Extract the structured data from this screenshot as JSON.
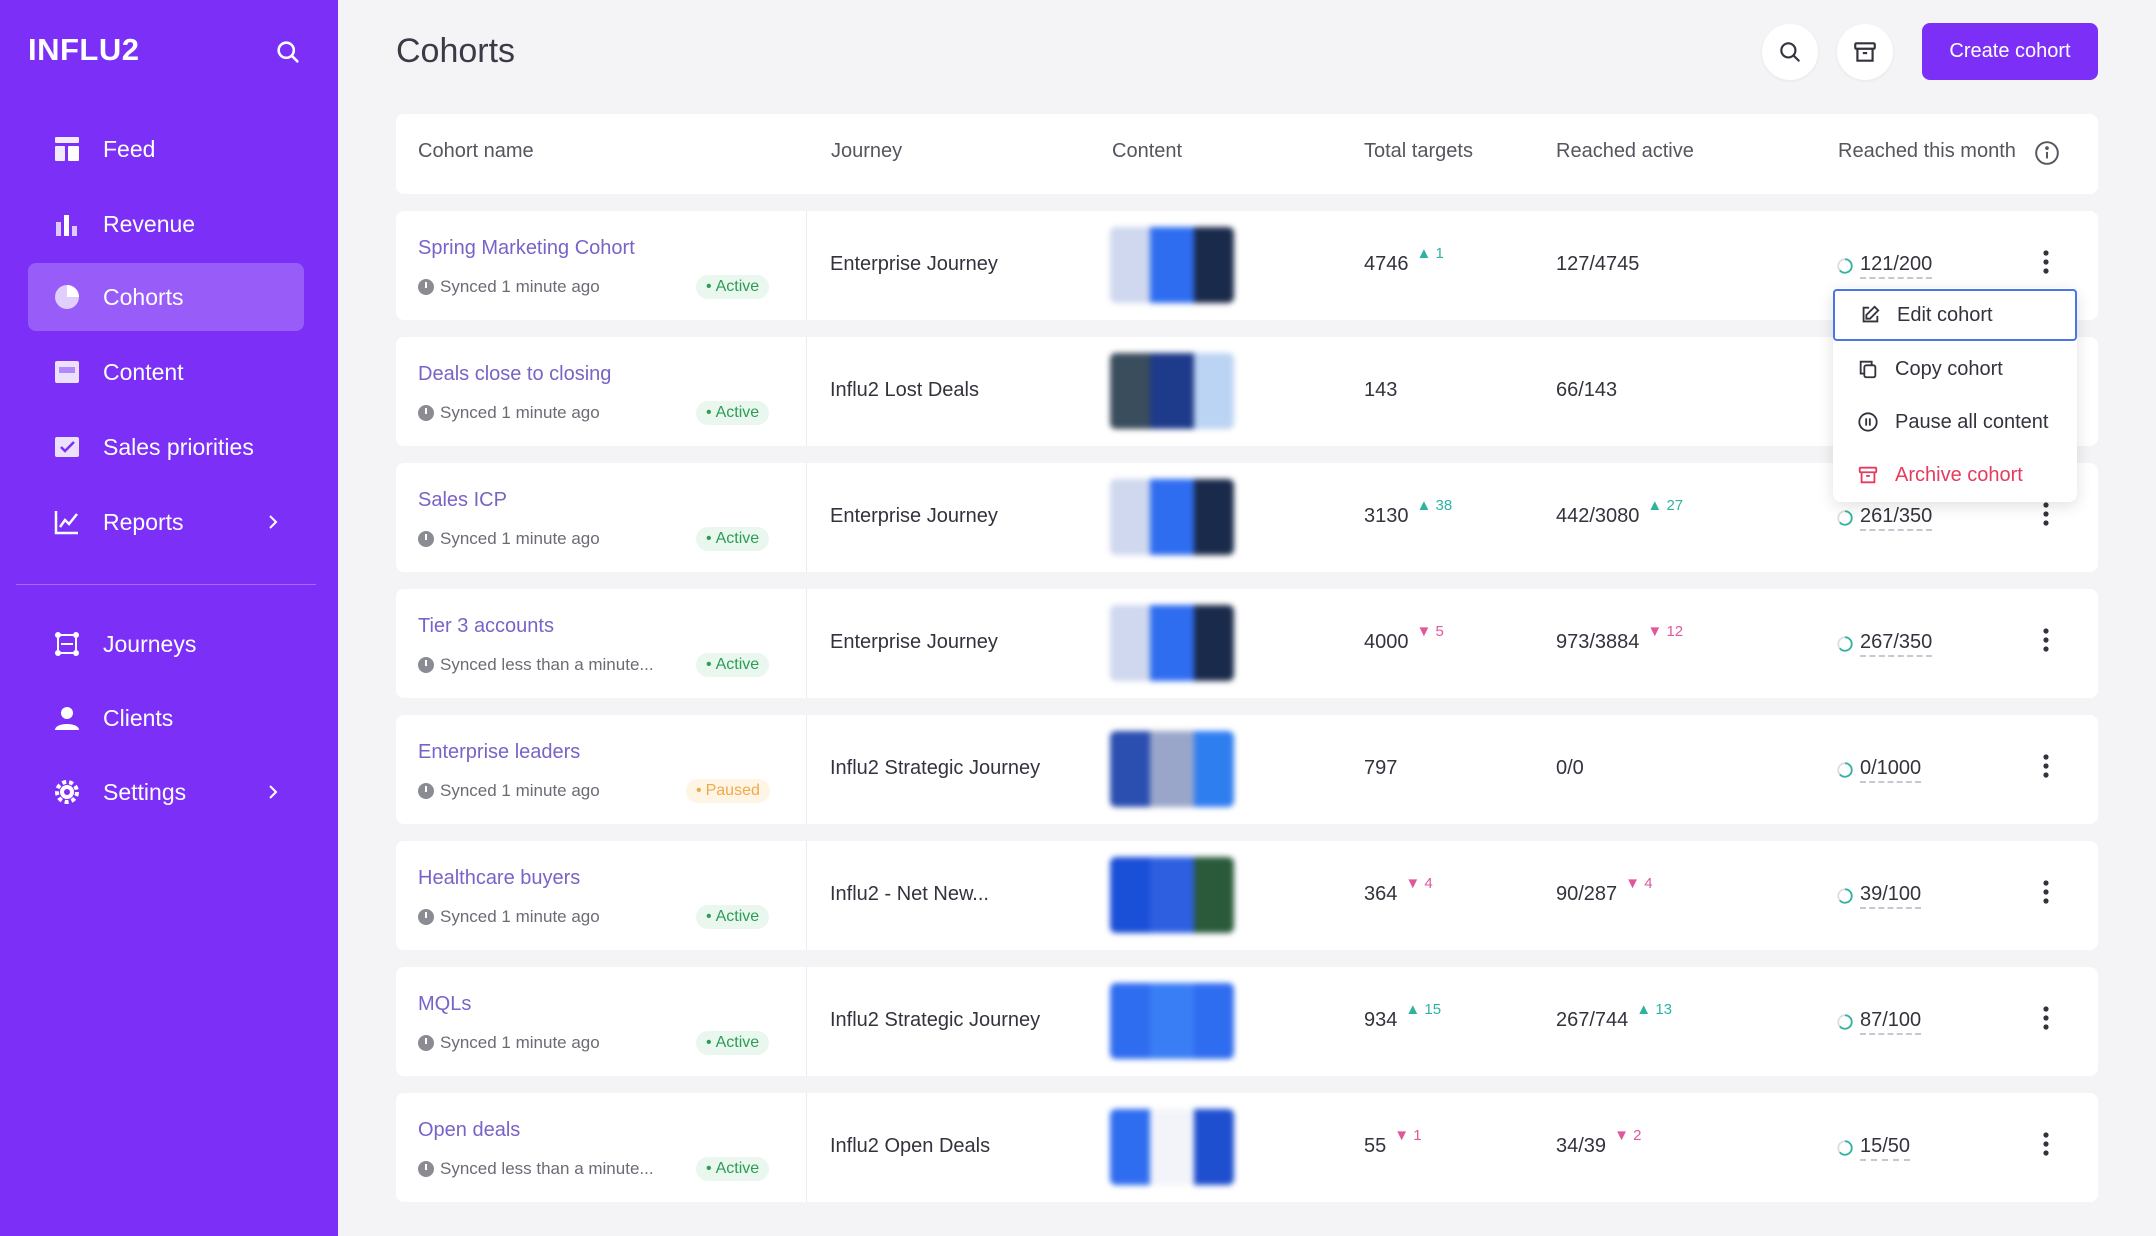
{
  "app": {
    "brand": "INFLU2"
  },
  "sidebar": {
    "items": [
      {
        "label": "Feed",
        "icon": "feed-icon"
      },
      {
        "label": "Revenue",
        "icon": "bar-chart-icon"
      },
      {
        "label": "Cohorts",
        "icon": "pie-chart-icon",
        "active": true
      },
      {
        "label": "Content",
        "icon": "content-icon"
      },
      {
        "label": "Sales priorities",
        "icon": "checkbox-icon"
      },
      {
        "label": "Reports",
        "icon": "line-chart-icon"
      },
      {
        "label": "Journeys",
        "icon": "journeys-icon"
      },
      {
        "label": "Clients",
        "icon": "user-icon"
      },
      {
        "label": "Settings",
        "icon": "gear-icon"
      }
    ]
  },
  "header": {
    "title": "Cohorts",
    "create_label": "Create cohort"
  },
  "table": {
    "columns": [
      "Cohort name",
      "Journey",
      "Content",
      "Total targets",
      "Reached active",
      "Reached this month"
    ],
    "rows": [
      {
        "name": "Spring Marketing Cohort",
        "sync": "Synced 1 minute ago",
        "status": "Active",
        "journey": "Enterprise Journey",
        "total": "4746",
        "total_delta": "1",
        "total_dir": "up",
        "reached": "127/4745",
        "reached_delta": "",
        "reached_dir": "",
        "month": "121/200"
      },
      {
        "name": "Deals close to closing",
        "sync": "Synced 1 minute ago",
        "status": "Active",
        "journey": "Influ2 Lost Deals",
        "total": "143",
        "total_delta": "",
        "total_dir": "",
        "reached": "66/143",
        "reached_delta": "",
        "reached_dir": "",
        "month": ""
      },
      {
        "name": "Sales ICP",
        "sync": "Synced 1 minute ago",
        "status": "Active",
        "journey": "Enterprise Journey",
        "total": "3130",
        "total_delta": "38",
        "total_dir": "up",
        "reached": "442/3080",
        "reached_delta": "27",
        "reached_dir": "up",
        "month": "261/350"
      },
      {
        "name": "Tier 3 accounts",
        "sync": "Synced less than a minute...",
        "status": "Active",
        "journey": "Enterprise Journey",
        "total": "4000",
        "total_delta": "5",
        "total_dir": "down",
        "reached": "973/3884",
        "reached_delta": "12",
        "reached_dir": "down",
        "month": "267/350"
      },
      {
        "name": "Enterprise leaders",
        "sync": "Synced 1 minute ago",
        "status": "Paused",
        "journey": "Influ2 Strategic Journey",
        "total": "797",
        "total_delta": "",
        "total_dir": "",
        "reached": "0/0",
        "reached_delta": "",
        "reached_dir": "",
        "month": "0/1000"
      },
      {
        "name": "Healthcare buyers",
        "sync": "Synced 1 minute ago",
        "status": "Active",
        "journey": "Influ2 - Net New...",
        "total": "364",
        "total_delta": "4",
        "total_dir": "down",
        "reached": "90/287",
        "reached_delta": "4",
        "reached_dir": "down",
        "month": "39/100"
      },
      {
        "name": "MQLs",
        "sync": "Synced 1 minute ago",
        "status": "Active",
        "journey": "Influ2 Strategic Journey",
        "total": "934",
        "total_delta": "15",
        "total_dir": "up",
        "reached": "267/744",
        "reached_delta": "13",
        "reached_dir": "up",
        "month": "87/100"
      },
      {
        "name": "Open deals",
        "sync": "Synced less than a minute...",
        "status": "Active",
        "journey": "Influ2 Open Deals",
        "total": "55",
        "total_delta": "1",
        "total_dir": "down",
        "reached": "34/39",
        "reached_delta": "2",
        "reached_dir": "down",
        "month": "15/50"
      }
    ]
  },
  "menu": {
    "items": [
      {
        "label": "Edit cohort",
        "icon": "edit-icon"
      },
      {
        "label": "Copy cohort",
        "icon": "copy-icon"
      },
      {
        "label": "Pause all content",
        "icon": "pause-icon"
      },
      {
        "label": "Archive cohort",
        "icon": "archive-icon"
      }
    ]
  },
  "colors": {
    "brand": "#7b2ff7",
    "up": "#2eb3a0",
    "down": "#e0589b",
    "danger": "#e33c5e"
  }
}
